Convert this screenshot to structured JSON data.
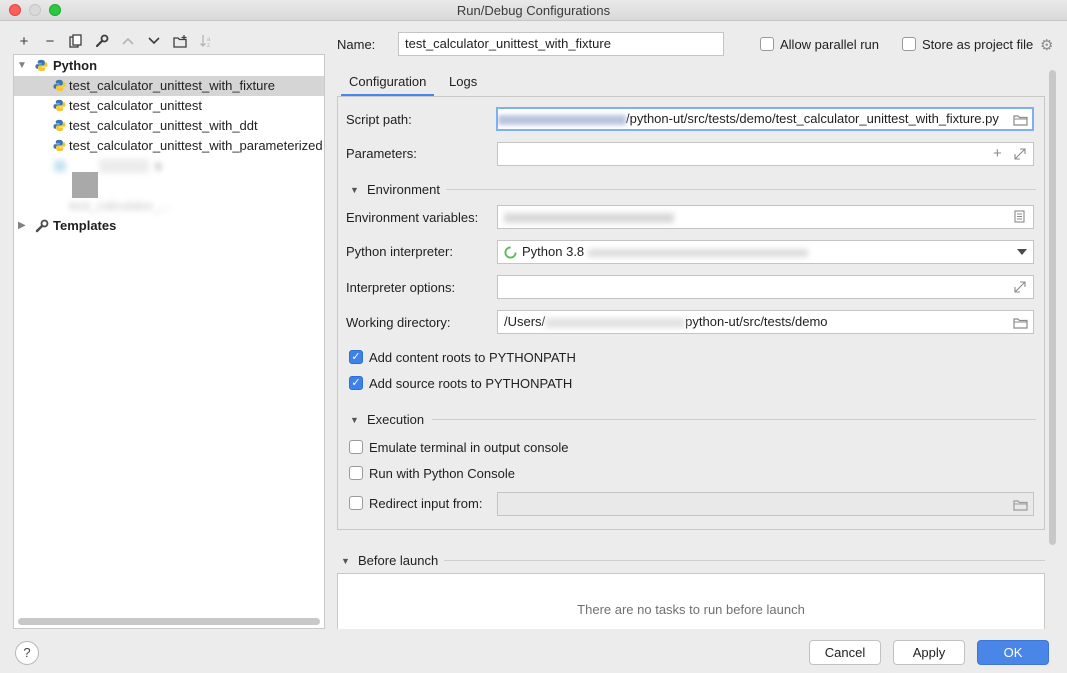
{
  "window": {
    "title": "Run/Debug Configurations"
  },
  "toolbar": {
    "add": "+",
    "remove": "−",
    "copy": "⧉",
    "edit": "🔧",
    "up": "▲",
    "down": "▼",
    "folder": "📁",
    "sort": "↓ᵃ"
  },
  "tree": {
    "python_group": "Python",
    "items": [
      "test_calculator_unittest_with_fixture",
      "test_calculator_unittest",
      "test_calculator_unittest_with_ddt",
      "test_calculator_unittest_with_parameterized"
    ],
    "hidden_item_partial_1": "s",
    "hidden_item_partial_2": "test_calculator_...",
    "templates": "Templates"
  },
  "form": {
    "name_label": "Name:",
    "name_value": "test_calculator_unittest_with_fixture",
    "allow_parallel": "Allow parallel run",
    "store_as_project": "Store as project file",
    "tabs": [
      "Configuration",
      "Logs"
    ],
    "script_path_label": "Script path:",
    "script_path_value": "/python-ut/src/tests/demo/test_calculator_unittest_with_fixture.py",
    "parameters_label": "Parameters:",
    "environment_section": "Environment",
    "env_vars_label": "Environment variables:",
    "interpreter_label": "Python interpreter:",
    "interpreter_value": "Python 3.8",
    "interpreter_options_label": "Interpreter options:",
    "working_dir_label": "Working directory:",
    "working_dir_prefix": "/Users/",
    "working_dir_suffix": "python-ut/src/tests/demo",
    "add_content_roots": "Add content roots to PYTHONPATH",
    "add_source_roots": "Add source roots to PYTHONPATH",
    "execution_section": "Execution",
    "emulate_terminal": "Emulate terminal in output console",
    "run_with_console": "Run with Python Console",
    "redirect_input": "Redirect input from:",
    "before_launch_section": "Before launch",
    "no_tasks": "There are no tasks to run before launch"
  },
  "buttons": {
    "help": "?",
    "cancel": "Cancel",
    "apply": "Apply",
    "ok": "OK"
  },
  "colors": {
    "accent": "#4a86e8",
    "selection": "#d5d5d5",
    "checkbox": "#3d82e8"
  }
}
